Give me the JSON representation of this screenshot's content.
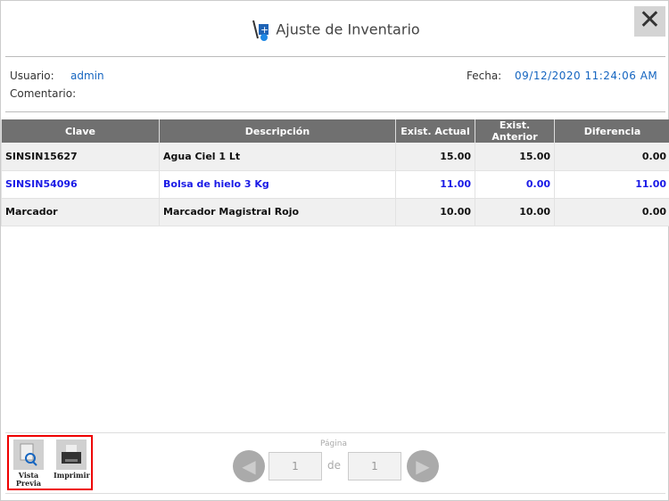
{
  "window": {
    "title": "Ajuste de Inventario",
    "close_label": "✕"
  },
  "info": {
    "usuario_label": "Usuario:",
    "usuario": "admin",
    "comentario_label": "Comentario:",
    "fecha_label": "Fecha:",
    "fecha": "09/12/2020 11:24:06 AM"
  },
  "table": {
    "headers": [
      "Clave",
      "Descripción",
      "Exist. Actual",
      "Exist. Anterior",
      "Diferencia"
    ],
    "rows": [
      [
        "SINSIN15627",
        "Agua Ciel 1 Lt",
        "15.00",
        "15.00",
        "0.00"
      ],
      [
        "SINSIN54096",
        "Bolsa de hielo 3 Kg",
        "11.00",
        "0.00",
        "11.00"
      ],
      [
        "Marcador",
        "Marcador Magistral Rojo",
        "10.00",
        "10.00",
        "0.00"
      ]
    ]
  },
  "toolbar": {
    "preview_label": "Vista Previa",
    "print_label": "Imprimir"
  },
  "pager": {
    "label": "Página",
    "current": "1",
    "of": "de",
    "total": "1"
  }
}
